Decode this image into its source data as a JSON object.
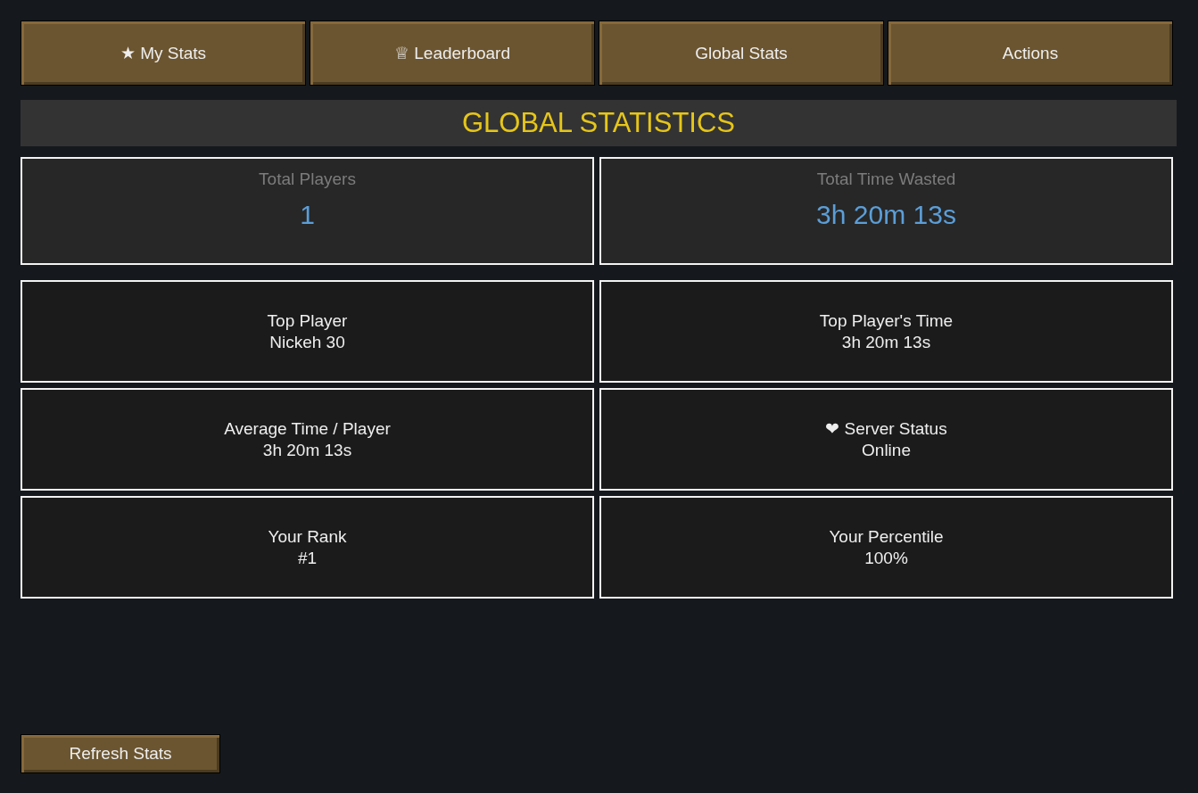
{
  "tabs": [
    {
      "label": "★ My Stats"
    },
    {
      "label": "♕ Leaderboard"
    },
    {
      "label": "Global Stats"
    },
    {
      "label": "Actions"
    }
  ],
  "heading": "GLOBAL STATISTICS",
  "summary": [
    {
      "label": "Total Players",
      "value": "1"
    },
    {
      "label": "Total Time Wasted",
      "value": "3h 20m 13s"
    }
  ],
  "details": [
    {
      "label": "Top Player",
      "value": "Nickeh 30"
    },
    {
      "label": "Top Player's Time",
      "value": "3h 20m 13s"
    },
    {
      "label": "Average Time / Player",
      "value": "3h 20m 13s"
    },
    {
      "label": "❤ Server Status",
      "value": "Online"
    },
    {
      "label": "Your Rank",
      "value": "#1"
    },
    {
      "label": "Your Percentile",
      "value": "100%"
    }
  ],
  "refresh_button": "Refresh Stats"
}
